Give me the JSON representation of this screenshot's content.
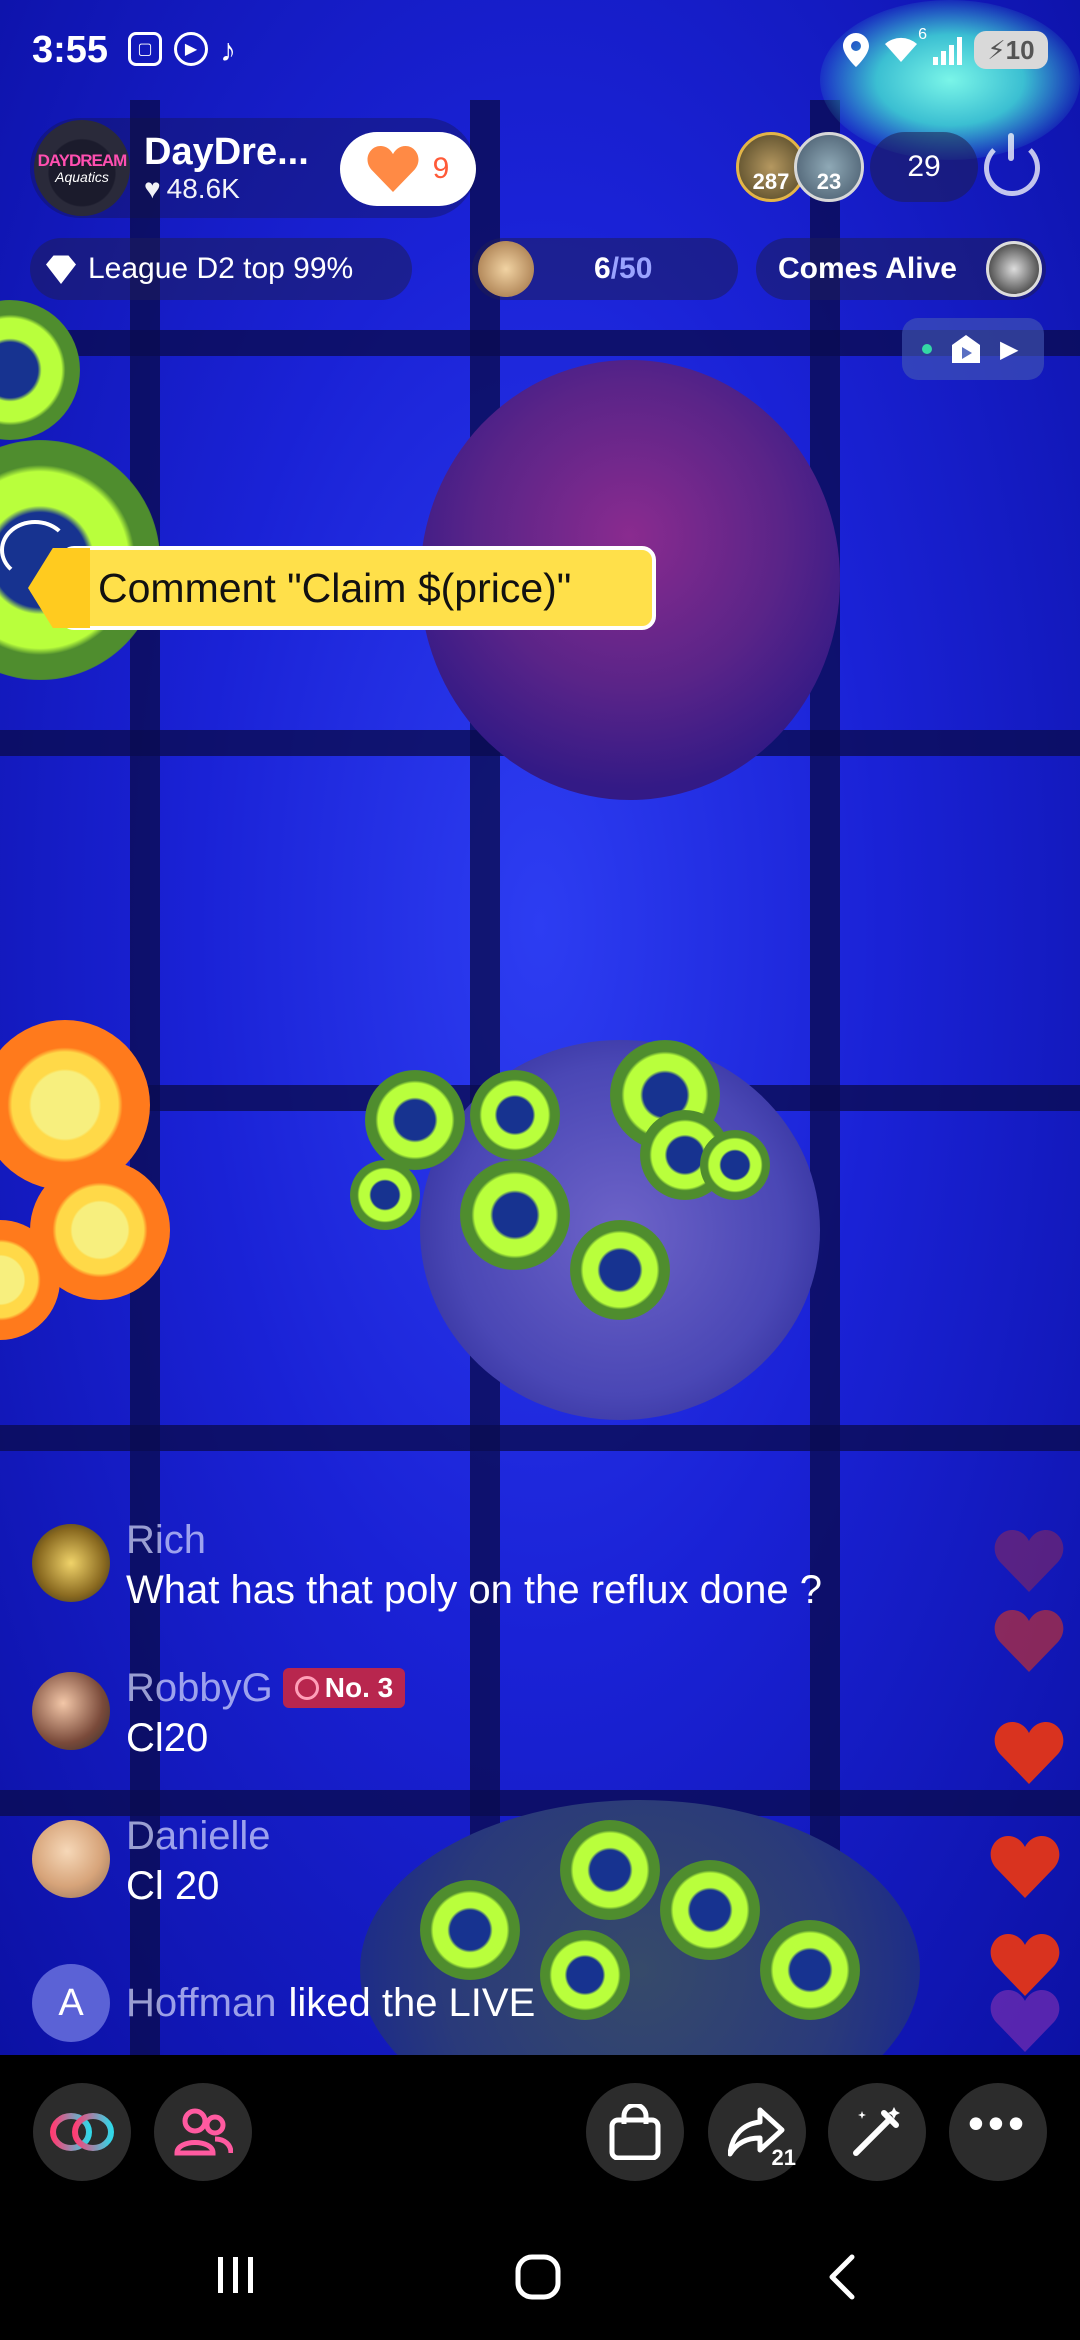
{
  "status_bar": {
    "time": "3:55",
    "battery": "10",
    "wifi_badge": "6"
  },
  "host": {
    "name": "DayDre...",
    "likes": "48.6K",
    "avatar_text_top": "DAYDREAM",
    "avatar_text_bottom": "Aquatics",
    "follow_count": "9"
  },
  "viewers": {
    "top_viewer_1": "287",
    "top_viewer_2": "23",
    "count": "29"
  },
  "league": {
    "label": "League D2 top 99%"
  },
  "goal": {
    "current": "6",
    "total": "/50"
  },
  "ranking": {
    "label": "Comes Alive"
  },
  "banner": {
    "text": "Comment \"Claim $(price)\""
  },
  "chat": {
    "messages": [
      {
        "name": "Rich",
        "text": "What has that poly on the reflux done ?"
      },
      {
        "name": "RobbyG",
        "badge": "No. 3",
        "text": "Cl20"
      },
      {
        "name": "Danielle",
        "text": "Cl 20"
      }
    ],
    "join": {
      "initial": "A",
      "name": "Hoffman",
      "action": "liked the LIVE"
    }
  },
  "actions": {
    "share_count": "21"
  },
  "colors": {
    "video_bg": "#1a22d6",
    "banner": "#ffe04a",
    "heart": "#d9331f"
  }
}
